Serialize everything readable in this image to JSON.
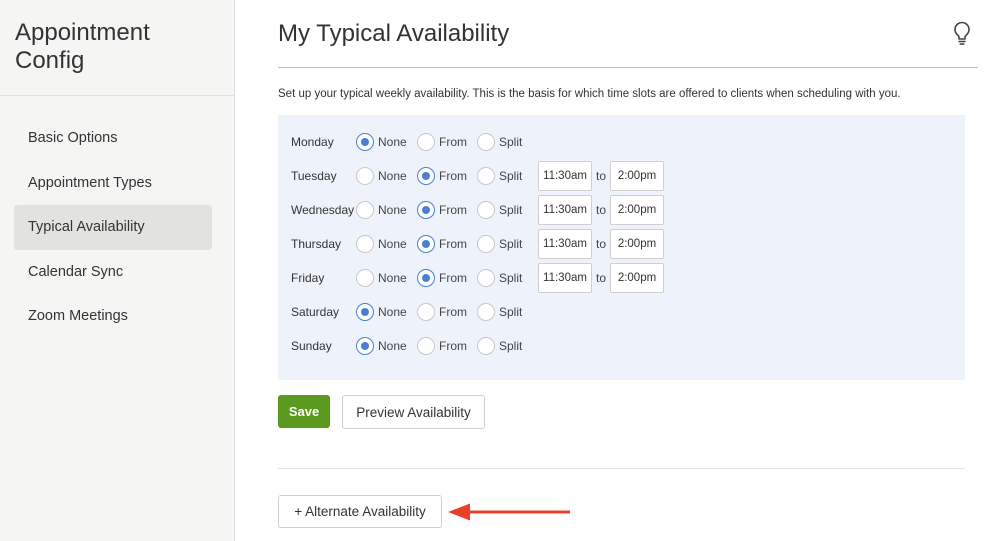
{
  "sidebar": {
    "title_line1": "Appointment",
    "title_line2": "Config",
    "items": [
      {
        "label": "Basic Options"
      },
      {
        "label": "Appointment Types"
      },
      {
        "label": "Typical Availability"
      },
      {
        "label": "Calendar Sync"
      },
      {
        "label": "Zoom Meetings"
      }
    ],
    "active_index": 2
  },
  "main": {
    "title": "My Typical Availability",
    "help_icon": "lightbulb-icon",
    "description": "Set up your typical weekly availability. This is the basis for which time slots are offered to clients when scheduling with you."
  },
  "availability": {
    "option_labels": {
      "none": "None",
      "from": "From",
      "split": "Split"
    },
    "to_label": "to",
    "days": [
      {
        "name": "Monday",
        "selected": "none"
      },
      {
        "name": "Tuesday",
        "selected": "from",
        "start": "11:30am",
        "end": "2:00pm"
      },
      {
        "name": "Wednesday",
        "selected": "from",
        "start": "11:30am",
        "end": "2:00pm"
      },
      {
        "name": "Thursday",
        "selected": "from",
        "start": "11:30am",
        "end": "2:00pm"
      },
      {
        "name": "Friday",
        "selected": "from",
        "start": "11:30am",
        "end": "2:00pm"
      },
      {
        "name": "Saturday",
        "selected": "none"
      },
      {
        "name": "Sunday",
        "selected": "none"
      }
    ]
  },
  "actions": {
    "save_label": "Save",
    "preview_label": "Preview Availability",
    "alternate_label": "+ Alternate Availability"
  },
  "colors": {
    "accent_radio": "#4a7fd4",
    "save_button": "#5a9a1e",
    "annotation_arrow": "#e8402a"
  }
}
